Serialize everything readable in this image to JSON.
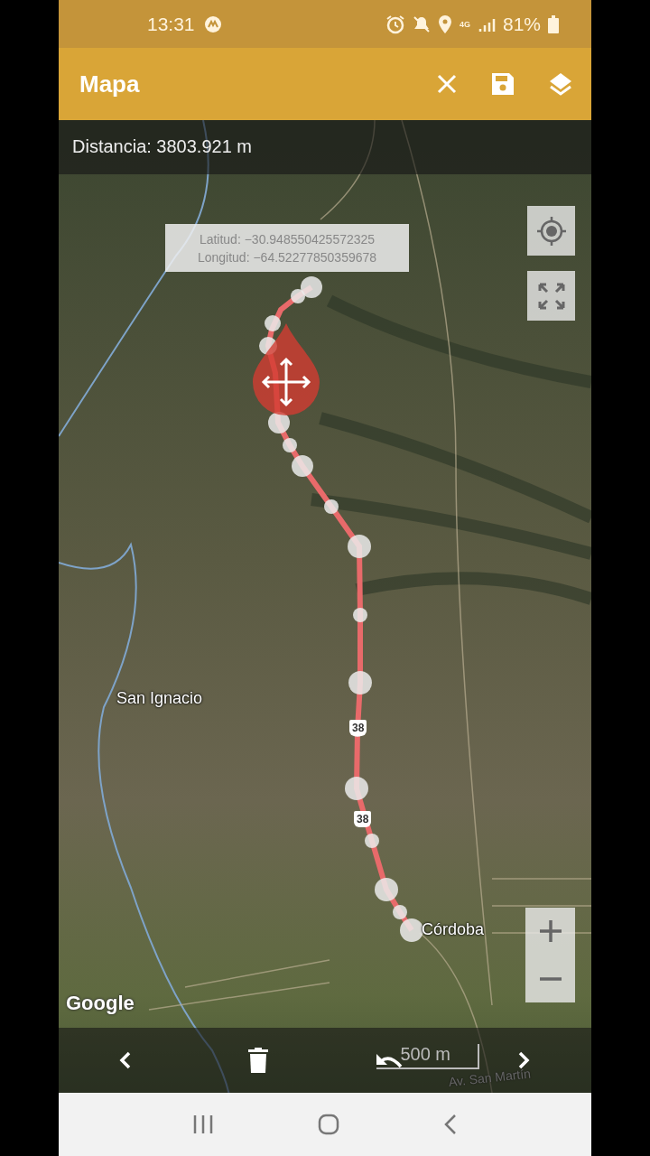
{
  "status_bar": {
    "time": "13:31",
    "network": "4G",
    "battery": "81%"
  },
  "app_bar": {
    "title": "Mapa"
  },
  "distance": "Distancia: 3803.921 m",
  "tooltip": {
    "lines": [
      "Latitud: −30.948550425572325",
      "Longitud: −64.52277850359678"
    ]
  },
  "map_labels": [
    {
      "kind": "place",
      "text": "San Ignacio"
    },
    {
      "kind": "shield",
      "text": "38"
    },
    {
      "kind": "shield",
      "text": "38"
    },
    {
      "kind": "place",
      "text": "Córdoba"
    },
    {
      "kind": "street",
      "text": "Av. San Martín"
    }
  ],
  "attribution": "Google",
  "scale": "500 m"
}
